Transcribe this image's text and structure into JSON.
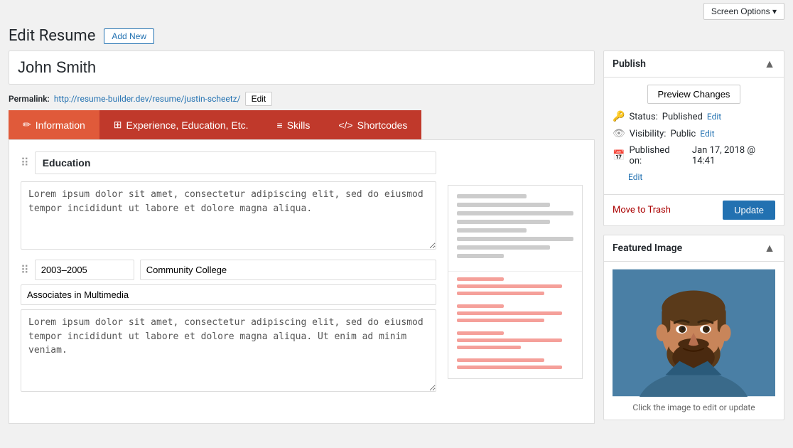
{
  "top": {
    "screen_options": "Screen Options ▾"
  },
  "header": {
    "page_title": "Edit Resume",
    "add_new": "Add New"
  },
  "title_input": {
    "value": "John Smith"
  },
  "permalink": {
    "label": "Permalink:",
    "url": "http://resume-builder.dev/resume/justin-scheetz/",
    "edit_btn": "Edit"
  },
  "tabs": [
    {
      "id": "information",
      "icon": "✏",
      "label": "Information",
      "active": true
    },
    {
      "id": "experience",
      "icon": "⊞",
      "label": "Experience, Education, Etc.",
      "active": false
    },
    {
      "id": "skills",
      "icon": "≡",
      "label": "Skills",
      "active": false
    },
    {
      "id": "shortcodes",
      "icon": "</>",
      "label": "Shortcodes",
      "active": false
    }
  ],
  "content": {
    "section_title": "Education",
    "section_textarea": "Lorem ipsum dolor sit amet, consectetur adipiscing elit, sed do eiusmod tempor incididunt ut labore et dolore magna aliqua.",
    "entry": {
      "date": "2003–2005",
      "place": "Community College",
      "degree": "Associates in Multimedia",
      "description": "Lorem ipsum dolor sit amet, consectetur adipiscing elit, sed do eiusmod tempor incididunt ut labore et dolore magna aliqua. Ut enim ad minim veniam."
    }
  },
  "publish_panel": {
    "title": "Publish",
    "preview_changes_btn": "Preview Changes",
    "status_label": "Status:",
    "status_value": "Published",
    "status_edit": "Edit",
    "visibility_label": "Visibility:",
    "visibility_value": "Public",
    "visibility_edit": "Edit",
    "published_label": "Published on:",
    "published_value": "Jan 17, 2018 @ 14:41",
    "published_edit": "Edit",
    "move_to_trash": "Move to Trash",
    "update_btn": "Update"
  },
  "featured_image_panel": {
    "title": "Featured Image",
    "caption": "Click the image to edit or update"
  }
}
